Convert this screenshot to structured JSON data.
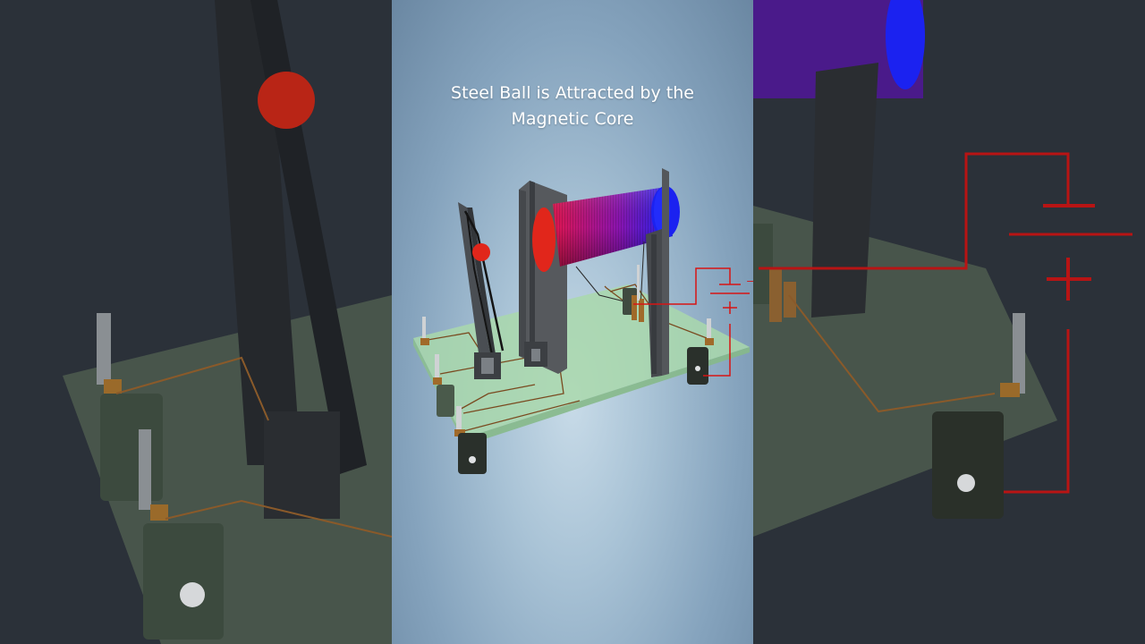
{
  "caption": {
    "line1": "Steel Ball is Attracted by the",
    "line2": "Magnetic Core"
  },
  "battery": {
    "minus_symbol": "−",
    "plus_symbol": "+"
  },
  "colors": {
    "ball": "#e1261b",
    "coil_start": "#e0154f",
    "coil_end": "#1b22f0",
    "board": "#9fd3a4",
    "wire": "#d71414",
    "frame": "#3f4348"
  }
}
